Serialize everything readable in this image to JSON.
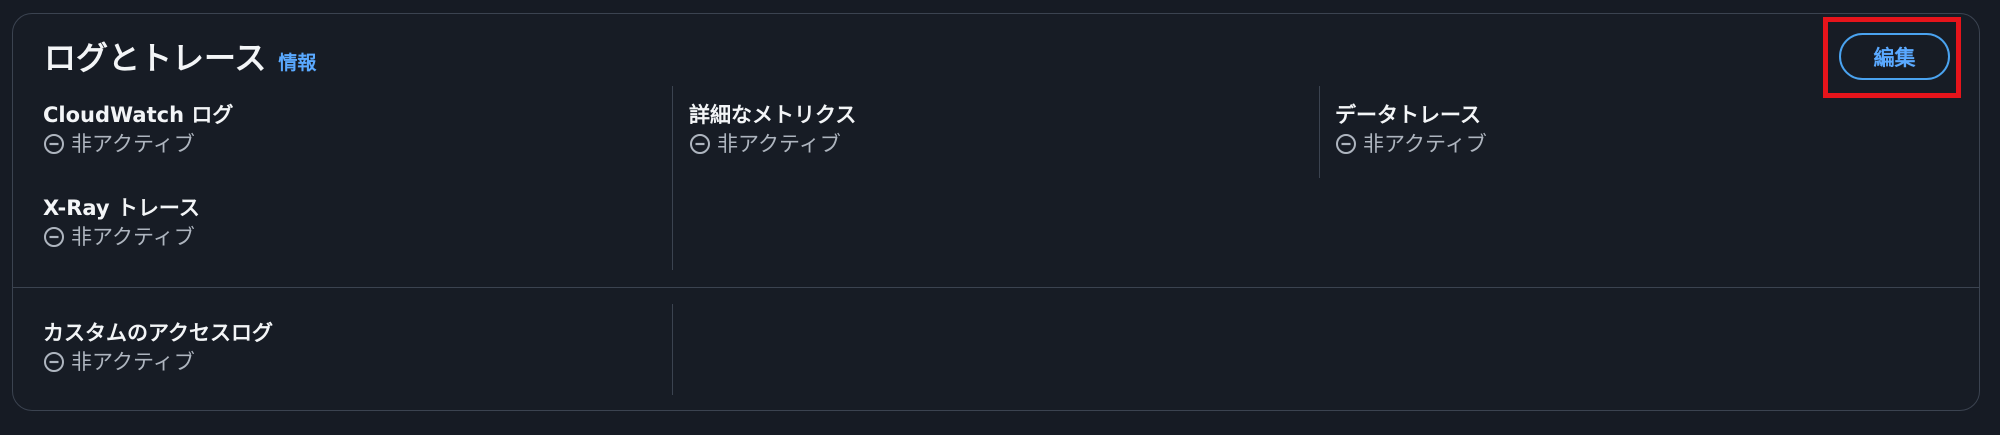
{
  "panel": {
    "title": "ログとトレース",
    "info_link": "情報",
    "edit_button": "編集"
  },
  "fields": {
    "cloudwatch_logs": {
      "label": "CloudWatch ログ",
      "status": "非アクティブ"
    },
    "xray_traces": {
      "label": "X-Ray トレース",
      "status": "非アクティブ"
    },
    "detailed_metrics": {
      "label": "詳細なメトリクス",
      "status": "非アクティブ"
    },
    "data_trace": {
      "label": "データトレース",
      "status": "非アクティブ"
    },
    "custom_access_logs": {
      "label": "カスタムのアクセスログ",
      "status": "非アクティブ"
    }
  },
  "icons": {
    "status": "minus-circle-icon"
  },
  "colors": {
    "background": "#161b24",
    "accent": "#5aa9ff",
    "highlight": "#e6141b",
    "text_primary": "#f3f5f7",
    "text_secondary": "#aeb5bf"
  }
}
